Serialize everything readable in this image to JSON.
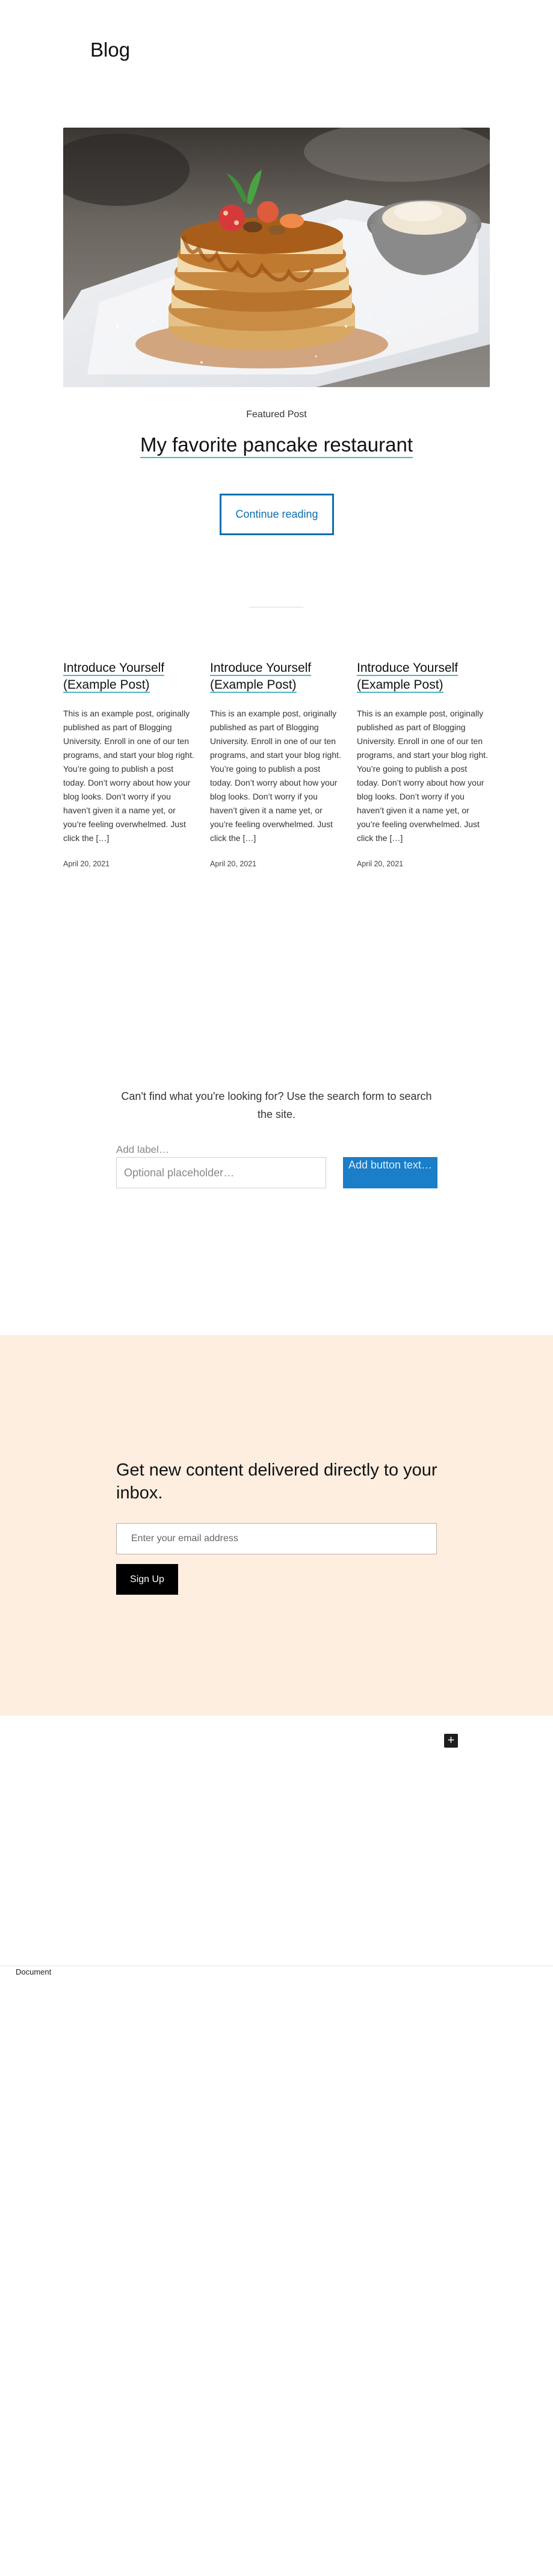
{
  "site": {
    "title": "Blog"
  },
  "featured": {
    "image_alt": "Stack of pancakes with caramel, strawberries and nuts",
    "label": "Featured Post",
    "title": "My favorite pancake restaurant",
    "cta": "Continue reading"
  },
  "posts": [
    {
      "title": "Introduce Yourself (Example Post)",
      "excerpt": "This is an example post, originally published as part of Blogging University. Enroll in one of our ten programs, and start your blog right. You’re going to publish a post today. Don’t worry about how your blog looks. Don’t worry if you haven’t given it a name yet, or you’re feeling overwhelmed. Just click the […]",
      "date": "April 20, 2021"
    },
    {
      "title": "Introduce Yourself (Example Post)",
      "excerpt": "This is an example post, originally published as part of Blogging University. Enroll in one of our ten programs, and start your blog right. You’re going to publish a post today. Don’t worry about how your blog looks. Don’t worry if you haven’t given it a name yet, or you’re feeling overwhelmed. Just click the […]",
      "date": "April 20, 2021"
    },
    {
      "title": "Introduce Yourself (Example Post)",
      "excerpt": "This is an example post, originally published as part of Blogging University. Enroll in one of our ten programs, and start your blog right. You’re going to publish a post today. Don’t worry about how your blog looks. Don’t worry if you haven’t given it a name yet, or you’re feeling overwhelmed. Just click the […]",
      "date": "April 20, 2021"
    }
  ],
  "search": {
    "prompt": "Can't find what you're looking for? Use the search form to search the site.",
    "label": "Add label…",
    "placeholder": "Optional placeholder…",
    "button": "Add button text…"
  },
  "subscribe": {
    "heading": "Get new content delivered directly to your inbox.",
    "email_placeholder": "Enter your email address",
    "button": "Sign Up"
  },
  "editor": {
    "add_block_icon": "plus-icon",
    "breadcrumb": "Document"
  },
  "colors": {
    "accent": "#0c6fae",
    "underline": "#4fb6c4",
    "search_button": "#1a7ec8",
    "subscribe_bg": "#fdeee0"
  }
}
